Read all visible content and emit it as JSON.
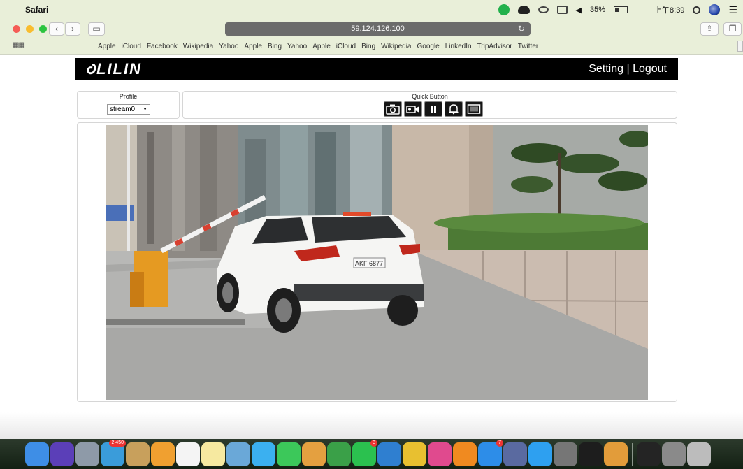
{
  "menubar": {
    "app_name": "Safari",
    "battery": "35%",
    "clock": "上午8:39"
  },
  "browser": {
    "address": "59.124.126.100",
    "bookmarks": [
      "Apple",
      "iCloud",
      "Facebook",
      "Wikipedia",
      "Yahoo",
      "Apple",
      "Bing",
      "Yahoo",
      "Apple",
      "iCloud",
      "Bing",
      "Wikipedia",
      "Google",
      "LinkedIn",
      "TripAdvisor",
      "Twitter"
    ]
  },
  "page": {
    "logo": "LILIN",
    "setting_label": "Setting",
    "separator": "|",
    "logout_label": "Logout",
    "profile": {
      "title": "Profile",
      "selected": "stream0"
    },
    "quick": {
      "title": "Quick Button",
      "buttons": [
        "camera-icon",
        "video-record-icon",
        "pause-icon",
        "bell-icon",
        "display-icon"
      ]
    },
    "video": {
      "plate": "AKF 6877"
    }
  },
  "dock": {
    "apps": [
      {
        "name": "finder-icon",
        "color": "#3e8ee6"
      },
      {
        "name": "siri-icon",
        "color": "#5b3fb8"
      },
      {
        "name": "launchpad-icon",
        "color": "#8e9aa8"
      },
      {
        "name": "stickies-icon",
        "color": "#3a9cda",
        "badge": "2,450"
      },
      {
        "name": "notes-icon",
        "color": "#c8a05c"
      },
      {
        "name": "photos-icon",
        "color": "#f0a030"
      },
      {
        "name": "calendar-icon",
        "color": "#f4f4f4"
      },
      {
        "name": "text-icon",
        "color": "#f6e9a0"
      },
      {
        "name": "preview-icon",
        "color": "#6aa8d8"
      },
      {
        "name": "messages-icon",
        "color": "#3bb0f0"
      },
      {
        "name": "facetime-icon",
        "color": "#3cc85a"
      },
      {
        "name": "sketch-icon",
        "color": "#e4a040"
      },
      {
        "name": "numbers-icon",
        "color": "#3aa048"
      },
      {
        "name": "line-icon",
        "color": "#2bc14f",
        "badge": "3"
      },
      {
        "name": "keynote-icon",
        "color": "#2f7fd0"
      },
      {
        "name": "chrome-icon",
        "color": "#e8c030"
      },
      {
        "name": "itunes-icon",
        "color": "#e04a8e"
      },
      {
        "name": "ibooks-icon",
        "color": "#f08a20"
      },
      {
        "name": "appstore-icon",
        "color": "#2d8de8",
        "badge": "7"
      },
      {
        "name": "image-capture-icon",
        "color": "#5a6aa0"
      },
      {
        "name": "safari-icon",
        "color": "#2ea0f0"
      },
      {
        "name": "system-preferences-icon",
        "color": "#767676"
      },
      {
        "name": "terminal-dark-icon",
        "color": "#1d1d1d"
      },
      {
        "name": "sublime-icon",
        "color": "#e29c3a"
      },
      {
        "name": "terminal-icon",
        "color": "#242424"
      },
      {
        "name": "photo-booth-icon",
        "color": "#8a8a8a"
      },
      {
        "name": "trash-icon",
        "color": "#bcbcbc"
      }
    ]
  }
}
